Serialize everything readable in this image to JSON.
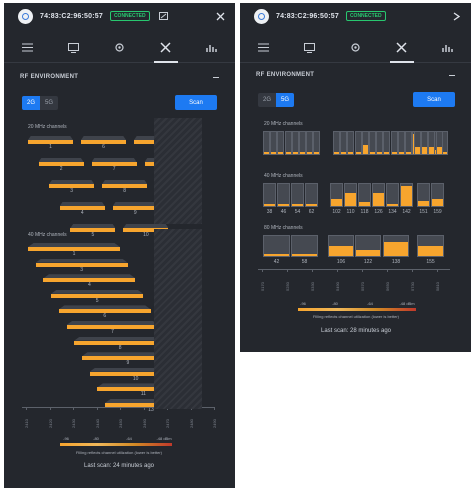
{
  "left": {
    "mac": "74:83:C2:96:50:57",
    "status": "CONNECTED",
    "section_title": "RF ENVIRONMENT",
    "bands": [
      "2G",
      "5G"
    ],
    "active_band": "2G",
    "scan_label": "Scan",
    "group20_label": "20 MHz channels",
    "channels20": [
      {
        "ch": "1",
        "util": 0.0
      },
      {
        "ch": "2",
        "util": 0.25
      },
      {
        "ch": "3",
        "util": 0.0
      },
      {
        "ch": "4",
        "util": 0.05
      },
      {
        "ch": "5",
        "util": 0.0
      },
      {
        "ch": "6",
        "util": 0.0
      },
      {
        "ch": "7",
        "util": 0.0
      },
      {
        "ch": "8",
        "util": 0.0
      },
      {
        "ch": "9",
        "util": 0.0
      },
      {
        "ch": "10",
        "util": 0.0
      },
      {
        "ch": "11",
        "util": 0.0
      },
      {
        "ch": "12",
        "util": 0.0
      },
      {
        "ch": "13",
        "util": 0.0
      }
    ],
    "group40_label": "40 MHz channels",
    "channels40": [
      "1",
      "3",
      "4",
      "5",
      "6",
      "7",
      "8",
      "9",
      "10",
      "11",
      "13"
    ],
    "freq_ticks": [
      "2410",
      "2420",
      "2430",
      "2440",
      "2450",
      "2460",
      "2470",
      "2480",
      "2490"
    ],
    "legend": [
      "-96",
      "-80",
      "-64",
      "-48 dBm"
    ],
    "legend_note": "Filling reflects channel utilization (lower is better)",
    "last_scan": "Last scan: 24 minutes ago"
  },
  "right": {
    "mac": "74:83:C2:96:50:57",
    "status": "CONNECTED",
    "section_title": "RF ENVIRONMENT",
    "bands": [
      "2G",
      "5G"
    ],
    "active_band": "5G",
    "scan_label": "Scan",
    "group20_label": "20 MHz channels",
    "group40_label": "40 MHz channels",
    "channels40": [
      {
        "ch": "38",
        "util": 0.1
      },
      {
        "ch": "46",
        "util": 0.1
      },
      {
        "ch": "54",
        "util": 0.1
      },
      {
        "ch": "62",
        "util": 0.1
      },
      {
        "ch": "102",
        "util": 0.3
      },
      {
        "ch": "110",
        "util": 0.6
      },
      {
        "ch": "118",
        "util": 0.2
      },
      {
        "ch": "126",
        "util": 0.6
      },
      {
        "ch": "134",
        "util": 0.1
      },
      {
        "ch": "142",
        "util": 0.9
      },
      {
        "ch": "151",
        "util": 0.25
      },
      {
        "ch": "159",
        "util": 0.3
      }
    ],
    "group80_label": "80 MHz channels",
    "channels80": [
      {
        "ch": "42",
        "util": 0.1
      },
      {
        "ch": "58",
        "util": 0.1
      },
      {
        "ch": "106",
        "util": 0.5
      },
      {
        "ch": "122",
        "util": 0.3
      },
      {
        "ch": "138",
        "util": 0.7
      },
      {
        "ch": "155",
        "util": 0.5
      }
    ],
    "freq_ticks": [
      "5170",
      "5250",
      "5330",
      "5490",
      "5570",
      "5650",
      "5730",
      "5810"
    ],
    "legend": [
      "-96",
      "-80",
      "-64",
      "-48 dBm"
    ],
    "legend_note": "Filling reflects channel utilization (lower is better)",
    "last_scan": "Last scan: 28 minutes ago"
  }
}
